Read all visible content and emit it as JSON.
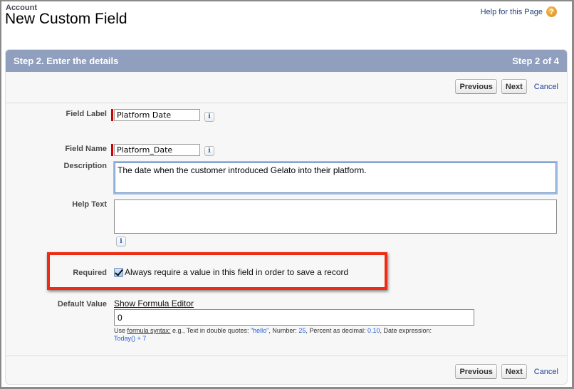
{
  "header": {
    "object_type": "Account",
    "title": "New Custom Field",
    "help_link": "Help for this Page",
    "help_icon": "question-circle-icon"
  },
  "panel": {
    "step_title": "Step 2. Enter the details",
    "step_counter": "Step 2 of 4",
    "buttons": {
      "previous": "Previous",
      "next": "Next",
      "cancel": "Cancel"
    }
  },
  "form": {
    "field_label": {
      "label": "Field Label",
      "value": "Platform Date",
      "required": true
    },
    "field_name": {
      "label": "Field Name",
      "value": "Platform_Date",
      "required": true
    },
    "description": {
      "label": "Description",
      "value": "The date when the customer introduced Gelato into their platform."
    },
    "help_text": {
      "label": "Help Text",
      "value": ""
    },
    "required": {
      "label": "Required",
      "checked": true,
      "checkbox_label": "Always require a value in this field in order to save a record"
    },
    "default_value": {
      "label": "Default Value",
      "formula_link": "Show Formula Editor",
      "value": "0",
      "hint": {
        "prefix": "Use ",
        "syntax_link": "formula syntax:",
        "part1": " e.g., Text in double quotes: ",
        "text_example": "\"hello\"",
        "part2": ", Number: ",
        "number_example": "25",
        "part3": ", Percent as decimal: ",
        "percent_example": "0.10",
        "part4": ", Date expression: ",
        "date_example": "Today() + 7"
      }
    },
    "info_icon": "i"
  },
  "annotation": {
    "highlight_color": "#f02b13",
    "highlights": "required-row"
  }
}
